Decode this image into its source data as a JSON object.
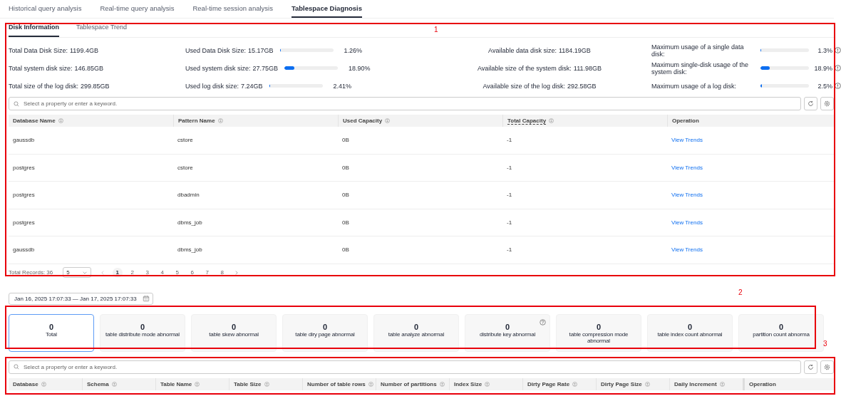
{
  "top_tabs": [
    {
      "label": "Historical query analysis",
      "selected": false
    },
    {
      "label": "Real-time query analysis",
      "selected": false
    },
    {
      "label": "Real-time session analysis",
      "selected": false
    },
    {
      "label": "Tablespace Diagnosis",
      "selected": true
    }
  ],
  "sub_tabs": [
    {
      "label": "Disk Information",
      "selected": true
    },
    {
      "label": "Tablespace Trend",
      "selected": false
    }
  ],
  "total_sizes": [
    {
      "label": "Total Data Disk Size:",
      "value": "1199.4GB"
    },
    {
      "label": "Total system disk size:",
      "value": "146.85GB"
    },
    {
      "label": "Total size of the log disk:",
      "value": "299.85GB"
    }
  ],
  "used_sizes": [
    {
      "label": "Used Data Disk Size:",
      "value": "15.17GB",
      "level": 0.0126,
      "percent": "1.26%"
    },
    {
      "label": "Used system disk size:",
      "value": "27.75GB",
      "level": 0.189,
      "percent": "18.90%"
    },
    {
      "label": "Used log disk size:",
      "value": "7.24GB",
      "level": 0.0241,
      "percent": "2.41%"
    }
  ],
  "available_sizes": [
    {
      "label": "Available data disk size:",
      "value": "1184.19GB"
    },
    {
      "label": "Available size of the system disk:",
      "value": "111.98GB"
    },
    {
      "label": "Available size of the log disk:",
      "value": "292.58GB"
    }
  ],
  "max_usage": [
    {
      "label": "Maximum usage of a single data disk:",
      "level": 0.013,
      "percent": "1.3%"
    },
    {
      "label": "Maximum single-disk usage of the system disk:",
      "level": 0.189,
      "percent": "18.9%"
    },
    {
      "label": "Maximum usage of a log disk:",
      "level": 0.025,
      "percent": "2.5%"
    }
  ],
  "disk_table": {
    "search": {
      "placeholder": "Select a property or enter a keyword."
    },
    "columns": [
      {
        "label": "Database Name",
        "sortable": true,
        "hint": false
      },
      {
        "label": "Pattern Name",
        "sortable": true,
        "hint": false
      },
      {
        "label": "Used Capacity",
        "sortable": true,
        "hint": false
      },
      {
        "label": "Total Capacity",
        "sortable": true,
        "hint": true
      },
      {
        "label": "Operation",
        "sortable": false,
        "hint": false
      }
    ],
    "rows": [
      [
        "gaussdb",
        "cstore",
        "0B",
        "-1",
        "View Trends"
      ],
      [
        "postgres",
        "cstore",
        "0B",
        "-1",
        "View Trends"
      ],
      [
        "postgres",
        "dbadmin",
        "0B",
        "-1",
        "View Trends"
      ],
      [
        "postgres",
        "dbms_job",
        "0B",
        "-1",
        "View Trends"
      ],
      [
        "gaussdb",
        "dbms_job",
        "0B",
        "-1",
        "View Trends"
      ]
    ]
  },
  "pagination": {
    "total": "Total Records: 36",
    "page_size": "5",
    "pages": [
      {
        "label": "1",
        "selected": true
      },
      {
        "label": "2",
        "selected": false
      },
      {
        "label": "3",
        "selected": false
      },
      {
        "label": "4",
        "selected": false
      },
      {
        "label": "5",
        "selected": false
      },
      {
        "label": "6",
        "selected": false
      },
      {
        "label": "7",
        "selected": false
      },
      {
        "label": "8",
        "selected": false
      }
    ]
  },
  "date_range": {
    "value": "Jan 16, 2025 17:07:33 — Jan 17, 2025 17:07:33"
  },
  "cards": [
    {
      "value": "0",
      "label": "Total",
      "selected": true,
      "help": false
    },
    {
      "value": "0",
      "label": "table distribute mode abnormal",
      "selected": false,
      "help": false
    },
    {
      "value": "0",
      "label": "table skew abnormal",
      "selected": false,
      "help": false
    },
    {
      "value": "0",
      "label": "table diry page abnormal",
      "selected": false,
      "help": false
    },
    {
      "value": "0",
      "label": "table analyze abnormal",
      "selected": false,
      "help": false
    },
    {
      "value": "0",
      "label": "distribute key abnormal",
      "selected": false,
      "help": true
    },
    {
      "value": "0",
      "label": "table compression mode abnormal",
      "selected": false,
      "help": false
    },
    {
      "value": "0",
      "label": "table index count abnormal",
      "selected": false,
      "help": false
    },
    {
      "value": "0",
      "label": "partition count abnorma",
      "selected": false,
      "help": false
    }
  ],
  "table_list": {
    "search": {
      "placeholder": "Select a property or enter a keyword."
    },
    "columns": [
      {
        "label": "Database",
        "sortable": true
      },
      {
        "label": "Schema",
        "sortable": true
      },
      {
        "label": "Table Name",
        "sortable": true
      },
      {
        "label": "Table Size",
        "sortable": true
      },
      {
        "label": "Number of table rows",
        "sortable": true
      },
      {
        "label": "Number of partitions",
        "sortable": true
      },
      {
        "label": "Index Size",
        "sortable": true
      },
      {
        "label": "Dirty Page Rate",
        "sortable": true
      },
      {
        "label": "Dirty Page Size",
        "sortable": true
      },
      {
        "label": "Daily Increment",
        "sortable": true
      },
      {
        "label": "Operation",
        "sortable": false
      }
    ]
  },
  "annotations": [
    {
      "label": "1"
    },
    {
      "label": "2"
    },
    {
      "label": "3"
    }
  ]
}
